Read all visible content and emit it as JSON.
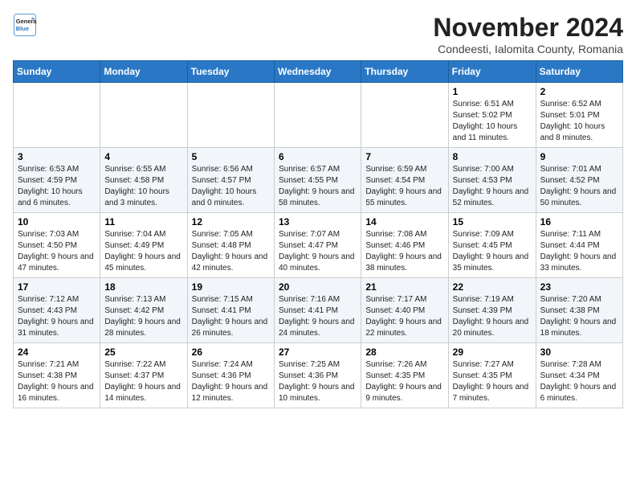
{
  "logo": {
    "line1": "General",
    "line2": "Blue"
  },
  "title": "November 2024",
  "subtitle": "Condeesti, Ialomita County, Romania",
  "weekdays": [
    "Sunday",
    "Monday",
    "Tuesday",
    "Wednesday",
    "Thursday",
    "Friday",
    "Saturday"
  ],
  "weeks": [
    [
      {
        "day": "",
        "info": ""
      },
      {
        "day": "",
        "info": ""
      },
      {
        "day": "",
        "info": ""
      },
      {
        "day": "",
        "info": ""
      },
      {
        "day": "",
        "info": ""
      },
      {
        "day": "1",
        "info": "Sunrise: 6:51 AM\nSunset: 5:02 PM\nDaylight: 10 hours and 11 minutes."
      },
      {
        "day": "2",
        "info": "Sunrise: 6:52 AM\nSunset: 5:01 PM\nDaylight: 10 hours and 8 minutes."
      }
    ],
    [
      {
        "day": "3",
        "info": "Sunrise: 6:53 AM\nSunset: 4:59 PM\nDaylight: 10 hours and 6 minutes."
      },
      {
        "day": "4",
        "info": "Sunrise: 6:55 AM\nSunset: 4:58 PM\nDaylight: 10 hours and 3 minutes."
      },
      {
        "day": "5",
        "info": "Sunrise: 6:56 AM\nSunset: 4:57 PM\nDaylight: 10 hours and 0 minutes."
      },
      {
        "day": "6",
        "info": "Sunrise: 6:57 AM\nSunset: 4:55 PM\nDaylight: 9 hours and 58 minutes."
      },
      {
        "day": "7",
        "info": "Sunrise: 6:59 AM\nSunset: 4:54 PM\nDaylight: 9 hours and 55 minutes."
      },
      {
        "day": "8",
        "info": "Sunrise: 7:00 AM\nSunset: 4:53 PM\nDaylight: 9 hours and 52 minutes."
      },
      {
        "day": "9",
        "info": "Sunrise: 7:01 AM\nSunset: 4:52 PM\nDaylight: 9 hours and 50 minutes."
      }
    ],
    [
      {
        "day": "10",
        "info": "Sunrise: 7:03 AM\nSunset: 4:50 PM\nDaylight: 9 hours and 47 minutes."
      },
      {
        "day": "11",
        "info": "Sunrise: 7:04 AM\nSunset: 4:49 PM\nDaylight: 9 hours and 45 minutes."
      },
      {
        "day": "12",
        "info": "Sunrise: 7:05 AM\nSunset: 4:48 PM\nDaylight: 9 hours and 42 minutes."
      },
      {
        "day": "13",
        "info": "Sunrise: 7:07 AM\nSunset: 4:47 PM\nDaylight: 9 hours and 40 minutes."
      },
      {
        "day": "14",
        "info": "Sunrise: 7:08 AM\nSunset: 4:46 PM\nDaylight: 9 hours and 38 minutes."
      },
      {
        "day": "15",
        "info": "Sunrise: 7:09 AM\nSunset: 4:45 PM\nDaylight: 9 hours and 35 minutes."
      },
      {
        "day": "16",
        "info": "Sunrise: 7:11 AM\nSunset: 4:44 PM\nDaylight: 9 hours and 33 minutes."
      }
    ],
    [
      {
        "day": "17",
        "info": "Sunrise: 7:12 AM\nSunset: 4:43 PM\nDaylight: 9 hours and 31 minutes."
      },
      {
        "day": "18",
        "info": "Sunrise: 7:13 AM\nSunset: 4:42 PM\nDaylight: 9 hours and 28 minutes."
      },
      {
        "day": "19",
        "info": "Sunrise: 7:15 AM\nSunset: 4:41 PM\nDaylight: 9 hours and 26 minutes."
      },
      {
        "day": "20",
        "info": "Sunrise: 7:16 AM\nSunset: 4:41 PM\nDaylight: 9 hours and 24 minutes."
      },
      {
        "day": "21",
        "info": "Sunrise: 7:17 AM\nSunset: 4:40 PM\nDaylight: 9 hours and 22 minutes."
      },
      {
        "day": "22",
        "info": "Sunrise: 7:19 AM\nSunset: 4:39 PM\nDaylight: 9 hours and 20 minutes."
      },
      {
        "day": "23",
        "info": "Sunrise: 7:20 AM\nSunset: 4:38 PM\nDaylight: 9 hours and 18 minutes."
      }
    ],
    [
      {
        "day": "24",
        "info": "Sunrise: 7:21 AM\nSunset: 4:38 PM\nDaylight: 9 hours and 16 minutes."
      },
      {
        "day": "25",
        "info": "Sunrise: 7:22 AM\nSunset: 4:37 PM\nDaylight: 9 hours and 14 minutes."
      },
      {
        "day": "26",
        "info": "Sunrise: 7:24 AM\nSunset: 4:36 PM\nDaylight: 9 hours and 12 minutes."
      },
      {
        "day": "27",
        "info": "Sunrise: 7:25 AM\nSunset: 4:36 PM\nDaylight: 9 hours and 10 minutes."
      },
      {
        "day": "28",
        "info": "Sunrise: 7:26 AM\nSunset: 4:35 PM\nDaylight: 9 hours and 9 minutes."
      },
      {
        "day": "29",
        "info": "Sunrise: 7:27 AM\nSunset: 4:35 PM\nDaylight: 9 hours and 7 minutes."
      },
      {
        "day": "30",
        "info": "Sunrise: 7:28 AM\nSunset: 4:34 PM\nDaylight: 9 hours and 6 minutes."
      }
    ]
  ]
}
